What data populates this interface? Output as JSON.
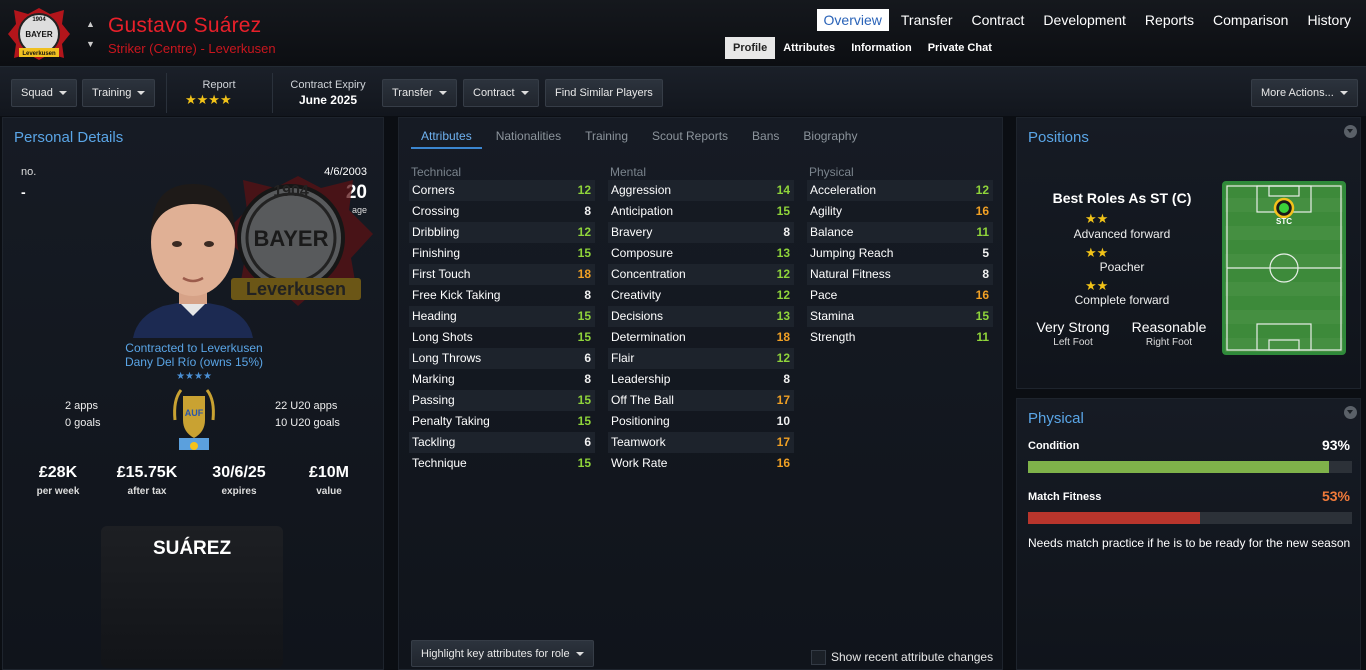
{
  "header": {
    "player_name": "Gustavo Suárez",
    "player_subtitle": "Striker (Centre) - Leverkusen",
    "nav_tabs": [
      "Overview",
      "Transfer",
      "Contract",
      "Development",
      "Reports",
      "Comparison",
      "History"
    ],
    "active_tab": "Overview",
    "sub_tabs": [
      "Profile",
      "Attributes",
      "Information",
      "Private Chat"
    ],
    "active_sub_tab": "Profile",
    "badge_text_top": "1904",
    "badge_text_mid": "BAYER",
    "badge_text_bottom": "Leverkusen"
  },
  "toolbar": {
    "squad_label": "Squad",
    "training_label": "Training",
    "report_label": "Report",
    "report_stars": "★★★★",
    "contract_label": "Contract Expiry",
    "contract_value": "June 2025",
    "transfer_label": "Transfer",
    "contract_btn_label": "Contract",
    "find_similar_label": "Find Similar Players",
    "more_actions_label": "More Actions..."
  },
  "personal": {
    "title": "Personal Details",
    "no_label": "no.",
    "no_value": "-",
    "dob": "4/6/2003",
    "age": "20",
    "age_label": "age",
    "contracted": "Contracted to Leverkusen",
    "owner": "Dany Del Río (owns 15%)",
    "nation_stars": "★★★★",
    "apps": "2 apps",
    "goals": "0 goals",
    "u20_apps": "22 U20 apps",
    "u20_goals": "10 U20 goals",
    "wage": "£28K",
    "wage_label": "per week",
    "after_tax": "£15.75K",
    "after_tax_label": "after tax",
    "expires": "30/6/25",
    "expires_label": "expires",
    "value": "£10M",
    "value_label": "value",
    "shirt_name": "SUÁREZ",
    "flag_text": "AUF",
    "badge_text_top": "1904",
    "badge_text_mid": "BAYER",
    "badge_text_bottom": "Leverkusen"
  },
  "attributes": {
    "tabs": [
      "Attributes",
      "Nationalities",
      "Training",
      "Scout Reports",
      "Bans",
      "Biography"
    ],
    "active_tab": "Attributes",
    "technical_header": "Technical",
    "mental_header": "Mental",
    "physical_header": "Physical",
    "technical": [
      {
        "name": "Corners",
        "value": "12",
        "color": "green"
      },
      {
        "name": "Crossing",
        "value": "8",
        "color": "white"
      },
      {
        "name": "Dribbling",
        "value": "12",
        "color": "green"
      },
      {
        "name": "Finishing",
        "value": "15",
        "color": "green"
      },
      {
        "name": "First Touch",
        "value": "18",
        "color": "orange"
      },
      {
        "name": "Free Kick Taking",
        "value": "8",
        "color": "white"
      },
      {
        "name": "Heading",
        "value": "15",
        "color": "green"
      },
      {
        "name": "Long Shots",
        "value": "15",
        "color": "green"
      },
      {
        "name": "Long Throws",
        "value": "6",
        "color": "white"
      },
      {
        "name": "Marking",
        "value": "8",
        "color": "white"
      },
      {
        "name": "Passing",
        "value": "15",
        "color": "green"
      },
      {
        "name": "Penalty Taking",
        "value": "15",
        "color": "green"
      },
      {
        "name": "Tackling",
        "value": "6",
        "color": "white"
      },
      {
        "name": "Technique",
        "value": "15",
        "color": "green"
      }
    ],
    "mental": [
      {
        "name": "Aggression",
        "value": "14",
        "color": "green"
      },
      {
        "name": "Anticipation",
        "value": "15",
        "color": "green"
      },
      {
        "name": "Bravery",
        "value": "8",
        "color": "white"
      },
      {
        "name": "Composure",
        "value": "13",
        "color": "green"
      },
      {
        "name": "Concentration",
        "value": "12",
        "color": "green"
      },
      {
        "name": "Creativity",
        "value": "12",
        "color": "green"
      },
      {
        "name": "Decisions",
        "value": "13",
        "color": "green"
      },
      {
        "name": "Determination",
        "value": "18",
        "color": "orange"
      },
      {
        "name": "Flair",
        "value": "12",
        "color": "green"
      },
      {
        "name": "Leadership",
        "value": "8",
        "color": "white"
      },
      {
        "name": "Off The Ball",
        "value": "17",
        "color": "orange"
      },
      {
        "name": "Positioning",
        "value": "10",
        "color": "white"
      },
      {
        "name": "Teamwork",
        "value": "17",
        "color": "orange"
      },
      {
        "name": "Work Rate",
        "value": "16",
        "color": "orange"
      }
    ],
    "physical": [
      {
        "name": "Acceleration",
        "value": "12",
        "color": "green"
      },
      {
        "name": "Agility",
        "value": "16",
        "color": "orange"
      },
      {
        "name": "Balance",
        "value": "11",
        "color": "green"
      },
      {
        "name": "Jumping Reach",
        "value": "5",
        "color": "white"
      },
      {
        "name": "Natural Fitness",
        "value": "8",
        "color": "white"
      },
      {
        "name": "Pace",
        "value": "16",
        "color": "orange"
      },
      {
        "name": "Stamina",
        "value": "15",
        "color": "green"
      },
      {
        "name": "Strength",
        "value": "11",
        "color": "green"
      }
    ],
    "highlight_label": "Highlight key attributes for role",
    "show_changes_label": "Show recent attribute changes"
  },
  "positions": {
    "title": "Positions",
    "best_roles": "Best Roles As ST (C)",
    "roles": [
      {
        "stars": "★★",
        "name": "Advanced forward"
      },
      {
        "stars": "★★",
        "name": "Poacher"
      },
      {
        "stars": "★★",
        "name": "Complete forward"
      }
    ],
    "left_foot": "Very Strong",
    "left_foot_label": "Left Foot",
    "right_foot": "Reasonable",
    "right_foot_label": "Right Foot",
    "pitch_position": "STC"
  },
  "physical": {
    "title": "Physical",
    "condition_label": "Condition",
    "condition_value": "93%",
    "condition_fraction": 0.93,
    "fitness_label": "Match Fitness",
    "fitness_value": "53%",
    "fitness_fraction": 0.53,
    "note": "Needs match practice if he is to be ready for the new season"
  },
  "colors": {
    "accent_blue": "#5aa5e6",
    "brand_red": "#e8202a",
    "attr_green": "#8fd43a",
    "attr_orange": "#f0a024",
    "condition_bar": "#7fb24a",
    "fitness_bar": "#b8352c",
    "fitness_text": "#f07a3a"
  }
}
